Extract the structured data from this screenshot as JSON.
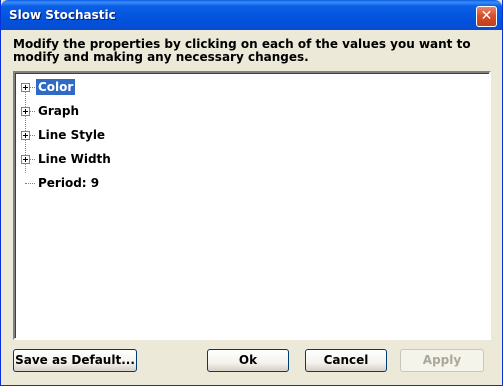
{
  "window": {
    "title": "Slow Stochastic"
  },
  "instructions": "Modify the properties by clicking on each of the values you want to modify and making any necessary changes.",
  "tree": {
    "items": [
      {
        "label": "Color",
        "expandable": true,
        "selected": true
      },
      {
        "label": "Graph",
        "expandable": true,
        "selected": false
      },
      {
        "label": "Line Style",
        "expandable": true,
        "selected": false
      },
      {
        "label": "Line Width",
        "expandable": true,
        "selected": false
      },
      {
        "label": "Period: 9",
        "expandable": false,
        "selected": false
      }
    ]
  },
  "buttons": {
    "save_default": "Save as Default...",
    "ok": "Ok",
    "cancel": "Cancel",
    "apply": "Apply",
    "apply_disabled": true
  },
  "icons": {
    "close": "close-icon",
    "expand": "plus-box-icon"
  },
  "colors": {
    "title_bar": "#0454df",
    "selection": "#316ac5",
    "dialog_bg": "#ece9d8"
  }
}
